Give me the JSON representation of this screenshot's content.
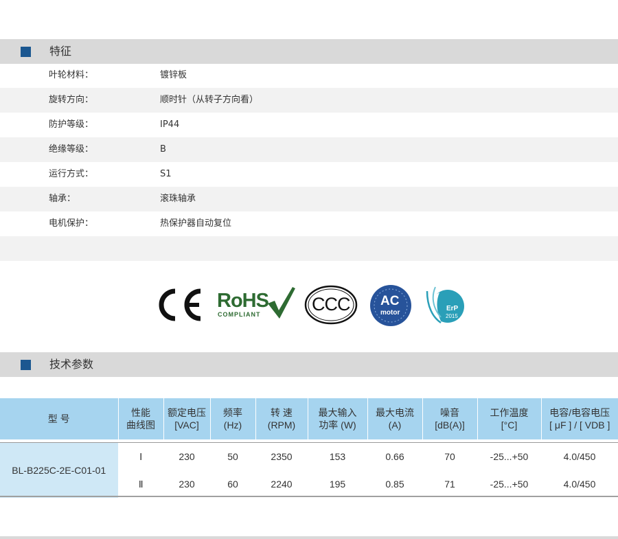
{
  "features": {
    "title": "特征",
    "rows": [
      {
        "key": "叶轮材料：",
        "value": "镀锌板"
      },
      {
        "key": "旋转方向：",
        "value": "顺时针（从转子方向看）"
      },
      {
        "key": "防护等级：",
        "value": "IP44"
      },
      {
        "key": "绝缘等级：",
        "value": "B"
      },
      {
        "key": "运行方式：",
        "value": "S1"
      },
      {
        "key": "轴承：",
        "value": "滚珠轴承"
      },
      {
        "key": "电机保护：",
        "value": "热保护器自动复位"
      }
    ]
  },
  "certifications": {
    "ce": "CE",
    "rohs": "RoHS",
    "rohs_sub": "COMPLIANT",
    "ccc": "CCC",
    "ac_top": "AC",
    "ac_bottom": "motor",
    "erp": "ErP",
    "erp_year": "2015",
    "colors": {
      "ce": "#111111",
      "rohs": "#2e6b32",
      "ac": "#27539a",
      "erp": "#2a9fb8"
    }
  },
  "specs": {
    "title": "技术参数",
    "headers": [
      [
        "型 号"
      ],
      [
        "性能",
        "曲线图"
      ],
      [
        "额定电压",
        "[VAC]"
      ],
      [
        "频率",
        "(Hz)"
      ],
      [
        "转 速",
        "(RPM)"
      ],
      [
        "最大输入",
        "功率 (W)"
      ],
      [
        "最大电流",
        "(A)"
      ],
      [
        "噪音",
        "[dB(A)]"
      ],
      [
        "工作温度",
        "[°C]"
      ],
      [
        "电容/电容电压",
        "[ μF ] / [ VDB ]"
      ]
    ],
    "model": "BL-B225C-2E-C01-01",
    "rows": [
      [
        "Ⅰ",
        "230",
        "50",
        "2350",
        "153",
        "0.66",
        "70",
        "-25...+50",
        "4.0/450"
      ],
      [
        "Ⅱ",
        "230",
        "60",
        "2240",
        "195",
        "0.85",
        "71",
        "-25...+50",
        "4.0/450"
      ]
    ],
    "colors": {
      "header": "#a6d4ef",
      "model_cell": "#cfe8f6",
      "accent": "#1b5790"
    }
  }
}
